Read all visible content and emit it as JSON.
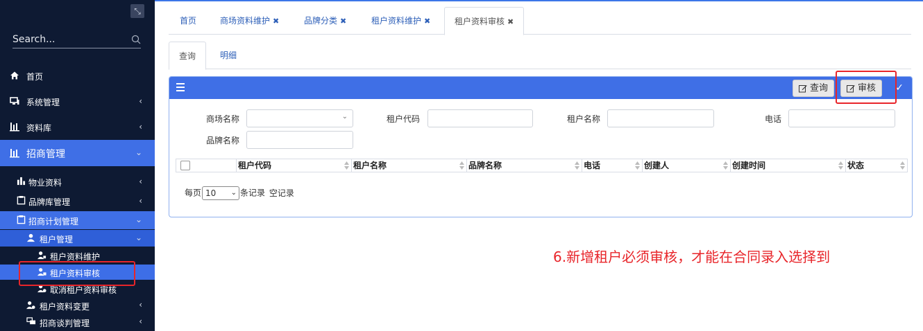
{
  "sidebar": {
    "search_placeholder": "Search...",
    "items": [
      {
        "label": "首页",
        "icon": "home-icon"
      },
      {
        "label": "系统管理",
        "icon": "monitor-icon"
      },
      {
        "label": "资料库",
        "icon": "building-icon"
      },
      {
        "label": "招商管理",
        "icon": "building-icon"
      },
      {
        "label": "物业资料",
        "icon": "chart-icon"
      },
      {
        "label": "品牌库管理",
        "icon": "clipboard-icon"
      },
      {
        "label": "招商计划管理",
        "icon": "clipboard-icon"
      },
      {
        "label": "租户管理",
        "icon": "user-icon"
      },
      {
        "label": "租户资料维护",
        "icon": "user-edit-icon"
      },
      {
        "label": "租户资料审核",
        "icon": "user-check-icon"
      },
      {
        "label": "取消租户资料审核",
        "icon": "user-cancel-icon"
      },
      {
        "label": "租户资料变更",
        "icon": "user-change-icon"
      },
      {
        "label": "招商谈判管理",
        "icon": "chat-icon"
      }
    ]
  },
  "tabs": [
    {
      "label": "首页",
      "closable": false
    },
    {
      "label": "商场资料维护",
      "closable": true
    },
    {
      "label": "品牌分类",
      "closable": true
    },
    {
      "label": "租户资料维护",
      "closable": true
    },
    {
      "label": "租户资料审核",
      "closable": true
    }
  ],
  "subtabs": [
    "查询",
    "明细"
  ],
  "toolbar": {
    "query_label": "查询",
    "audit_label": "审核"
  },
  "form": {
    "mall_name_label": "商场名称",
    "tenant_code_label": "租户代码",
    "tenant_name_label": "租户名称",
    "phone_label": "电话",
    "brand_name_label": "品牌名称"
  },
  "grid": {
    "columns": [
      "租户代码",
      "租户名称",
      "品牌名称",
      "电话",
      "创建人",
      "创建时间",
      "状态"
    ]
  },
  "pager": {
    "prefix": "每页",
    "page_size": "10",
    "suffix": "条记录",
    "empty_text": "空记录"
  },
  "annotation": "6.新增租户必须审核，才能在合同录入选择到",
  "colors": {
    "sidebar_bg": "#0e1a33",
    "accent": "#3f6fe6",
    "highlight": "#e8252a"
  }
}
